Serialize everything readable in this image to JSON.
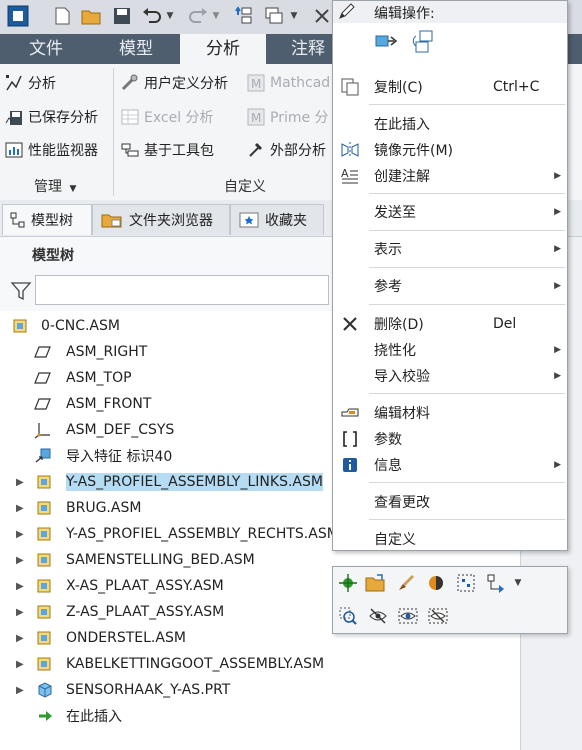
{
  "quick_access": {
    "icons": [
      "app-icon",
      "new-icon",
      "open-icon",
      "save-icon",
      "undo-icon",
      "redo-icon",
      "regenerate-icon",
      "windows-icon",
      "close-icon"
    ]
  },
  "ribbon_tabs": [
    {
      "label": "文件"
    },
    {
      "label": "模型"
    },
    {
      "label": "分析"
    },
    {
      "label": "注释"
    }
  ],
  "ribbon": {
    "manage": {
      "items": [
        {
          "label": "分析"
        },
        {
          "label": "已保存分析"
        },
        {
          "label": "性能监视器"
        }
      ],
      "group_label": "管理"
    },
    "custom": {
      "col1": [
        {
          "label": "用户定义分析",
          "disabled": false
        },
        {
          "label": "Excel 分析",
          "disabled": true
        },
        {
          "label": "基于工具包",
          "disabled": false
        }
      ],
      "col2": [
        {
          "label": "Mathcad",
          "disabled": true
        },
        {
          "label": "Prime 分",
          "disabled": true
        },
        {
          "label": "外部分析",
          "disabled": false
        }
      ],
      "group_label": "自定义"
    }
  },
  "navigator_tabs": [
    {
      "label": "模型树"
    },
    {
      "label": "文件夹浏览器"
    },
    {
      "label": "收藏夹"
    }
  ],
  "model_tree": {
    "heading": "模型树",
    "filter_placeholder": "",
    "items": [
      {
        "label": "0-CNC.ASM",
        "type": "assembly-root",
        "expandable": false
      },
      {
        "label": "ASM_RIGHT",
        "type": "datum-plane",
        "expandable": false
      },
      {
        "label": "ASM_TOP",
        "type": "datum-plane",
        "expandable": false
      },
      {
        "label": "ASM_FRONT",
        "type": "datum-plane",
        "expandable": false
      },
      {
        "label": "ASM_DEF_CSYS",
        "type": "csys",
        "expandable": false
      },
      {
        "label": "导入特征 标识40",
        "type": "import-feature",
        "expandable": false
      },
      {
        "label": "Y-AS_PROFIEL_ASSEMBLY_LINKS.ASM",
        "type": "assembly",
        "expandable": true,
        "selected": true
      },
      {
        "label": "BRUG.ASM",
        "type": "assembly",
        "expandable": true
      },
      {
        "label": "Y-AS_PROFIEL_ASSEMBLY_RECHTS.ASM",
        "type": "assembly",
        "expandable": true
      },
      {
        "label": "SAMENSTELLING_BED.ASM",
        "type": "assembly",
        "expandable": true
      },
      {
        "label": "X-AS_PLAAT_ASSY.ASM",
        "type": "assembly",
        "expandable": true
      },
      {
        "label": "Z-AS_PLAAT_ASSY.ASM",
        "type": "assembly",
        "expandable": true
      },
      {
        "label": "ONDERSTEL.ASM",
        "type": "assembly",
        "expandable": true
      },
      {
        "label": "KABELKETTINGGOOT_ASSEMBLY.ASM",
        "type": "assembly",
        "expandable": true
      },
      {
        "label": "SENSORHAAK_Y-AS.PRT",
        "type": "part",
        "expandable": true
      },
      {
        "label": "在此插入",
        "type": "insert-here",
        "expandable": false
      }
    ]
  },
  "context_menu": {
    "header": "编辑操作:",
    "items": [
      {
        "label": "复制(C)",
        "shortcut": "Ctrl+C",
        "icon": "copy-icon",
        "submenu": false
      },
      {
        "label": "在此插入",
        "shortcut": "",
        "icon": "",
        "submenu": false
      },
      {
        "label": "镜像元件(M)",
        "shortcut": "",
        "icon": "mirror-icon",
        "submenu": false
      },
      {
        "label": "创建注解",
        "shortcut": "",
        "icon": "annotation-icon",
        "submenu": true
      },
      {
        "label": "发送至",
        "shortcut": "",
        "icon": "",
        "submenu": true
      },
      {
        "label": "表示",
        "shortcut": "",
        "icon": "",
        "submenu": true
      },
      {
        "label": "参考",
        "shortcut": "",
        "icon": "",
        "submenu": true
      },
      {
        "label": "删除(D)",
        "shortcut": "Del",
        "icon": "delete-icon",
        "submenu": false
      },
      {
        "label": "挠性化",
        "shortcut": "",
        "icon": "",
        "submenu": true
      },
      {
        "label": "导入校验",
        "shortcut": "",
        "icon": "",
        "submenu": true
      },
      {
        "label": "编辑材料",
        "shortcut": "",
        "icon": "material-icon",
        "submenu": false
      },
      {
        "label": "参数",
        "shortcut": "",
        "icon": "parameters-icon",
        "submenu": false
      },
      {
        "label": "信息",
        "shortcut": "",
        "icon": "info-icon",
        "submenu": true
      },
      {
        "label": "查看更改",
        "shortcut": "",
        "icon": "",
        "submenu": false
      },
      {
        "label": "自定义",
        "shortcut": "",
        "icon": "",
        "submenu": false
      }
    ]
  },
  "mini_toolbar": {
    "icons": [
      "edit-definition-icon",
      "open-icon",
      "appearance-icon",
      "color-ball-icon",
      "select-icon",
      "reroute-icon",
      "dropdown-icon",
      "zoom-fit-icon",
      "hide-icon",
      "show-icon",
      "unhide-icon"
    ]
  },
  "colors": {
    "tab_bar": "#4e5e6e",
    "selection": "#b5dcf3",
    "ribbon_bg": "#f4f5f7"
  }
}
